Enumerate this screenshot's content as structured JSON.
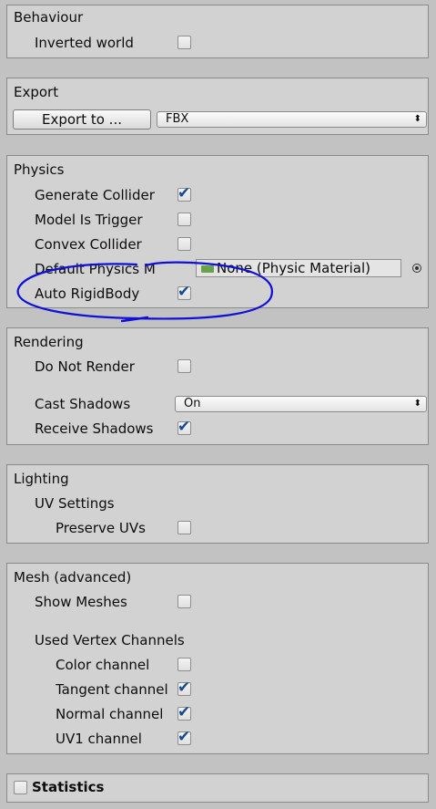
{
  "behaviour": {
    "title": "Behaviour",
    "inverted_world": "Inverted world"
  },
  "export": {
    "title": "Export",
    "button": "Export to ...",
    "format": "FBX"
  },
  "physics": {
    "title": "Physics",
    "generate_collider": "Generate Collider",
    "model_is_trigger": "Model Is Trigger",
    "convex_collider": "Convex Collider",
    "default_physics_material": "Default Physics M",
    "material_value": "None (Physic Material)",
    "auto_rigidbody": "Auto RigidBody"
  },
  "rendering": {
    "title": "Rendering",
    "do_not_render": "Do Not Render",
    "cast_shadows": "Cast Shadows",
    "cast_shadows_value": "On",
    "receive_shadows": "Receive Shadows"
  },
  "lighting": {
    "title": "Lighting",
    "uv_settings": "UV Settings",
    "preserve_uvs": "Preserve UVs"
  },
  "mesh": {
    "title": "Mesh (advanced)",
    "show_meshes": "Show Meshes",
    "used_vertex_channels": "Used Vertex Channels",
    "color_channel": "Color channel",
    "tangent_channel": "Tangent channel",
    "normal_channel": "Normal channel",
    "uv1_channel": "UV1 channel"
  },
  "statistics": {
    "title": "Statistics"
  },
  "checks": {
    "inverted_world": false,
    "generate_collider": true,
    "model_is_trigger": false,
    "convex_collider": false,
    "auto_rigidbody": true,
    "do_not_render": false,
    "receive_shadows": true,
    "preserve_uvs": false,
    "show_meshes": false,
    "color_channel": false,
    "tangent_channel": true,
    "normal_channel": true,
    "uv1_channel": true,
    "statistics": false
  },
  "icons": {
    "checkmark": "✔",
    "dropdown": "⬍"
  },
  "colors": {
    "annotation_stroke": "#1010d8",
    "check_color": "#174a8f"
  }
}
